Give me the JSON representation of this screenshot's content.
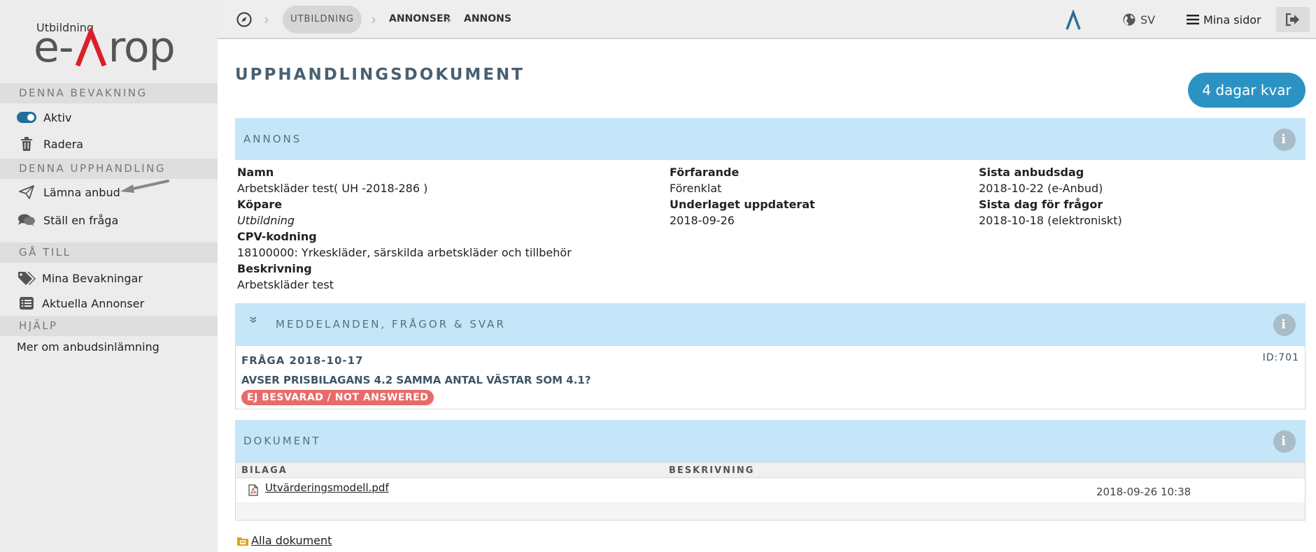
{
  "logo": {
    "small": "Utbildning",
    "left": "e-",
    "right": "rop"
  },
  "sidebar": {
    "sections": [
      {
        "title": "DENNA BEVAKNING"
      },
      {
        "title": "DENNA UPPHANDLING"
      },
      {
        "title": "GÅ TILL"
      },
      {
        "title": "HJÄLP"
      }
    ],
    "items": [
      {
        "label": "Aktiv"
      },
      {
        "label": "Radera"
      },
      {
        "label": "Lämna anbud"
      },
      {
        "label": "Ställ en fråga"
      },
      {
        "label": "Mina Bevakningar"
      },
      {
        "label": "Aktuella Annonser"
      },
      {
        "label": "Mer om anbudsinlämning"
      }
    ]
  },
  "breadcrumb": {
    "items": [
      "UTBILDNING",
      "ANNONSER",
      "ANNONS"
    ]
  },
  "topbar": {
    "lang": "SV",
    "menu": "Mina sidor"
  },
  "page": {
    "title": "UPPHANDLINGSDOKUMENT",
    "days_left": "4 dagar kvar"
  },
  "annons": {
    "header": "ANNONS",
    "fields": {
      "namn_label": "Namn",
      "namn_value": "Arbetskläder test( UH -2018-286 )",
      "kopare_label": "Köpare",
      "kopare_value": "Utbildning",
      "cpv_label": "CPV-kodning",
      "cpv_value": "18100000: Yrkeskläder, särskilda arbetskläder och tillbehör",
      "beskrivning_label": "Beskrivning",
      "beskrivning_value": "Arbetskläder test",
      "forfarande_label": "Förfarande",
      "forfarande_value": "Förenklat",
      "uppdaterat_label": "Underlaget uppdaterat",
      "uppdaterat_value": "2018-09-26",
      "anbudsdag_label": "Sista anbudsdag",
      "anbudsdag_value": "2018-10-22 (e-Anbud)",
      "fragor_label": "Sista dag för frågor",
      "fragor_value": "2018-10-18 (elektroniskt)"
    }
  },
  "messages": {
    "header": "MEDDELANDEN, FRÅGOR & SVAR",
    "item": {
      "date": "FRÅGA 2018-10-17",
      "id": "ID:701",
      "question": "AVSER PRISBILAGANS 4.2 SAMMA ANTAL VÄSTAR SOM 4.1?",
      "status": "EJ BESVARAD / NOT ANSWERED"
    }
  },
  "documents": {
    "header": "DOKUMENT",
    "columns": [
      "BILAGA",
      "BESKRIVNING"
    ],
    "rows": [
      {
        "name": "Utvärderingsmodell.pdf",
        "date": "2018-09-26 10:38"
      }
    ],
    "all_link": "Alla dokument"
  },
  "colors": {
    "accent": "#2b93c4",
    "panel": "#c5e6f8",
    "danger": "#e96a6a",
    "logo_red": "#d9202a"
  }
}
